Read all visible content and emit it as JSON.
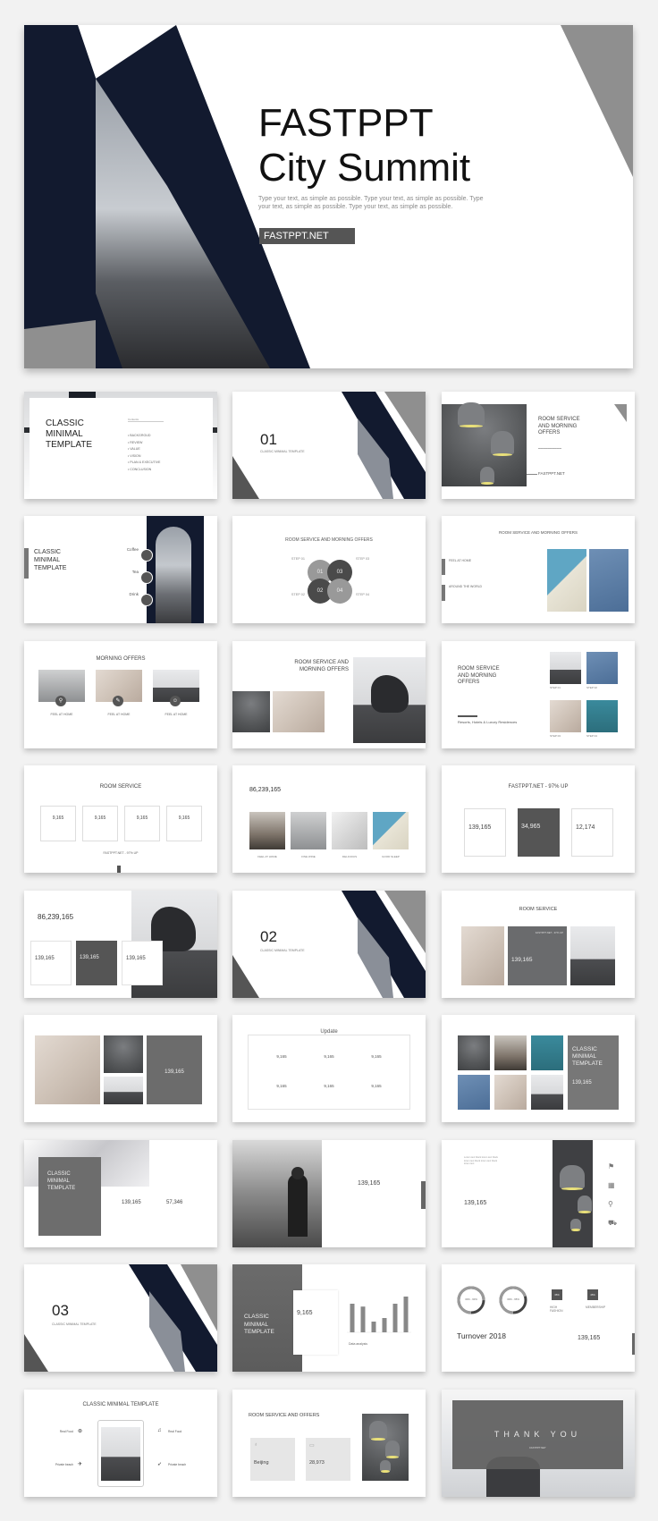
{
  "hero": {
    "title_line1": "FASTPPT",
    "title_line2": "City Summit",
    "body": "Type your text, as simple as possible. Type your text, as simple as possible. Type your text, as simple as possible. Type your text, as simple as possible.",
    "button_label": "FASTPPT.NET"
  },
  "colors": {
    "navy": "#121a2f",
    "gray": "#8f8f8f",
    "dark_gray": "#555555",
    "lamp_glow": "#e9e07a"
  },
  "slides": {
    "s1": {
      "title": [
        "CLASSIC",
        "MINIMAL",
        "TEMPLATE"
      ],
      "contents_label": "Contents",
      "items": [
        "BACKGROUD",
        "REVIEW",
        "VALUE",
        "VISION",
        "PLAN & EXECUTIVE",
        "CONCLUSION"
      ]
    },
    "s2": {
      "number": "01",
      "subtitle": "CLASSIC MINIMAL TEMPLATE"
    },
    "s3": {
      "title": [
        "ROOM SERVICE",
        "AND MORNING",
        "OFFERS"
      ],
      "link": "FASTPPT.NET"
    },
    "s4": {
      "title": [
        "CLASSIC",
        "MINIMAL",
        "TEMPLATE"
      ],
      "items": [
        "Coffee",
        "Tea",
        "Drink"
      ]
    },
    "s5": {
      "title": "ROOM SERVICE AND MORNING OFFERS",
      "steps": [
        "STEP 01",
        "STEP 02",
        "STEP 03",
        "STEP 04"
      ],
      "circles": [
        "01",
        "03",
        "02",
        "04"
      ]
    },
    "s6": {
      "title": "ROOM SERVICE AND MORNING OFFERS",
      "items": [
        "FEEL AT HOME",
        "AROUND THE WORLD"
      ]
    },
    "s7": {
      "title": "MORNING OFFERS",
      "items": [
        "FEEL AT HOME",
        "FEEL AT HOME",
        "FEEL AT HOME"
      ]
    },
    "s8": {
      "title": [
        "ROOM SERVICE AND",
        "MORNING OFFERS"
      ]
    },
    "s9": {
      "title": [
        "ROOM SERVICE",
        "AND MORNING",
        "OFFERS"
      ],
      "tagline": "Resorts, Hotels & Luxury Residences",
      "steps": [
        "STEP 01",
        "STEP 02",
        "STEP 03",
        "STEP 04"
      ]
    },
    "s10": {
      "title": "ROOM SERVICE",
      "values": [
        "9,165",
        "9,165",
        "9,165",
        "9,165"
      ],
      "footer": "FASTPPT.NET - 97% UP"
    },
    "s11": {
      "value": "86,239,165",
      "labels": [
        "FEEL AT HOME",
        "FINE WINE",
        "DELICIOUS",
        "GOOD SLEEP"
      ]
    },
    "s12": {
      "title": "FASTPPT.NET - 97% UP",
      "values": [
        "139,165",
        "34,965",
        "12,174"
      ]
    },
    "s13": {
      "value": "86,239,165",
      "cards": [
        "139,165",
        "139,165",
        "139,165"
      ]
    },
    "s14": {
      "number": "02",
      "subtitle": "CLASSIC MINIMAL TEMPLATE"
    },
    "s15": {
      "title": "ROOM SERVICE",
      "caption": "FASTPPT.NET - 97% UP",
      "value": "139,165"
    },
    "s16": {
      "value": "139,165"
    },
    "s17": {
      "title": "Update",
      "values": [
        "9,165",
        "9,165",
        "9,165",
        "9,165",
        "9,165",
        "9,165"
      ]
    },
    "s18": {
      "title": [
        "CLASSIC",
        "MINIMAL",
        "TEMPLATE"
      ],
      "value": "139,165"
    },
    "s19": {
      "title": [
        "CLASSIC",
        "MINIMAL",
        "TEMPLATE"
      ],
      "values": [
        "139,165",
        "57,346"
      ]
    },
    "s20": {
      "value": "139,165"
    },
    "s21": {
      "value": "139,165"
    },
    "s22": {
      "number": "03",
      "subtitle": "CLASSIC MINIMAL TEMPLATE"
    },
    "s23": {
      "title": [
        "CLASSIC",
        "MINIMAL",
        "TEMPLATE"
      ],
      "value": "9,165",
      "chart_label": "Data analysis",
      "bars": [
        80,
        72,
        30,
        40,
        80,
        100
      ]
    },
    "s24": {
      "donuts": [
        "30% - 60%",
        "30% - 65%"
      ],
      "donut_fractions": [
        0.75,
        0.7
      ],
      "badges": [
        {
          "pct": "35%",
          "label": [
            "HIGH",
            "FASHION"
          ]
        },
        {
          "pct": "45%",
          "label": [
            "MEMBERSHIP"
          ]
        }
      ],
      "heading": "Turnover 2018",
      "value": "139,165"
    },
    "s25": {
      "title": "CLASSIC MINIMAL TEMPLATE",
      "items": [
        "Real Food",
        "Private beach",
        "Real Food",
        "Private beach"
      ]
    },
    "s26": {
      "title": "ROOM SERVICE AND OFFERS",
      "cards": [
        "Beijing",
        "28,973"
      ]
    },
    "s27": {
      "title": "THANK YOU",
      "subtitle": "FASTPPT.NET"
    }
  }
}
